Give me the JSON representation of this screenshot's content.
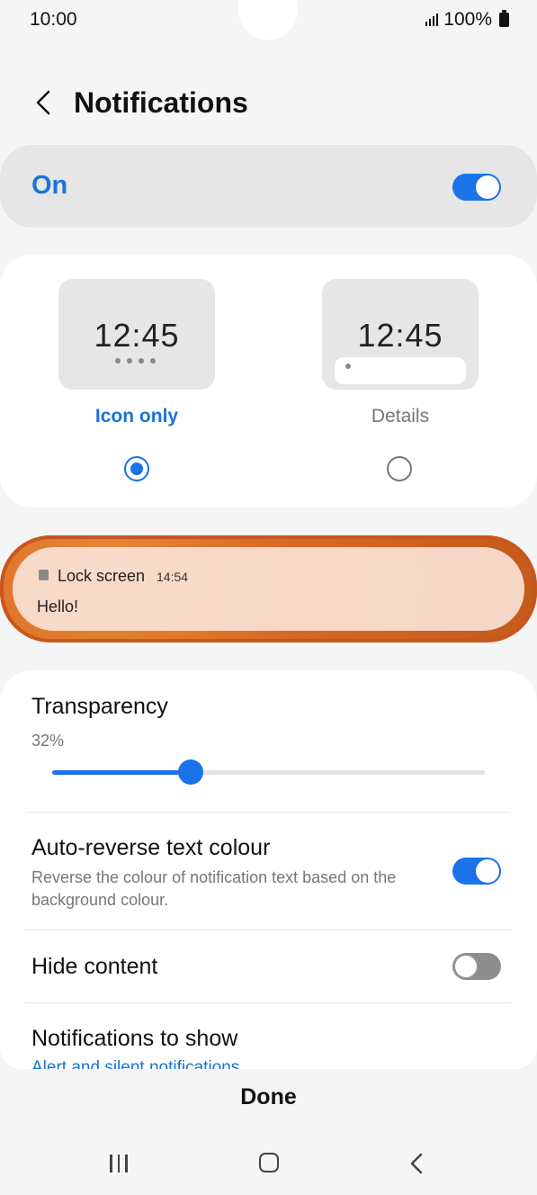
{
  "status_bar": {
    "time": "10:00",
    "battery": "100%"
  },
  "header": {
    "title": "Notifications"
  },
  "master_switch": {
    "label": "On",
    "enabled": true
  },
  "style_options": {
    "icon_only": {
      "preview_time": "12:45",
      "label": "Icon only",
      "selected": true
    },
    "details": {
      "preview_time": "12:45",
      "label": "Details",
      "selected": false
    }
  },
  "lock_preview": {
    "app": "Lock screen",
    "time": "14:54",
    "message": "Hello!"
  },
  "settings": {
    "transparency": {
      "title": "Transparency",
      "value_text": "32%",
      "value": 32
    },
    "auto_reverse": {
      "title": "Auto-reverse text colour",
      "subtitle": "Reverse the colour of notification text based on the background colour.",
      "enabled": true
    },
    "hide_content": {
      "title": "Hide content",
      "enabled": false
    },
    "notifications_to_show": {
      "title": "Notifications to show",
      "value": "Alert and silent notifications"
    }
  },
  "footer": {
    "done_label": "Done"
  },
  "colors": {
    "accent": "#1a73e8",
    "toggle_off": "#8e8e8e"
  },
  "icons": {
    "back": "back-arrow-icon",
    "recents": "recents-icon",
    "home": "home-icon",
    "nav_back": "nav-back-icon"
  }
}
